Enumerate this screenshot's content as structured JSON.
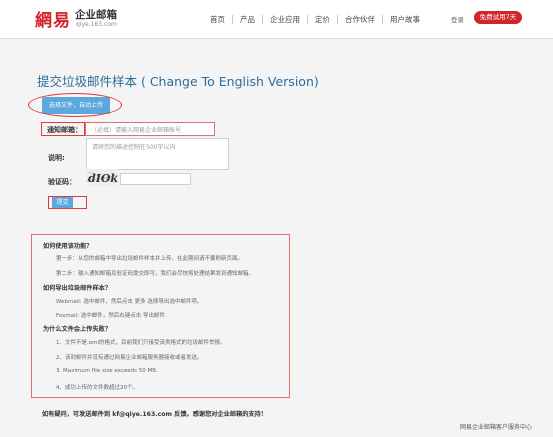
{
  "header": {
    "logo_mark": "網易",
    "logo_title": "企业邮箱",
    "logo_sub": "qiye.163.com",
    "nav": [
      {
        "label": "首页",
        "name": "nav-home"
      },
      {
        "label": "产品",
        "name": "nav-product"
      },
      {
        "label": "企业应用",
        "name": "nav-enterprise-apps"
      },
      {
        "label": "定价",
        "name": "nav-pricing"
      },
      {
        "label": "合作伙伴",
        "name": "nav-partners"
      },
      {
        "label": "用户故事",
        "name": "nav-user-stories"
      }
    ],
    "login_label": "登录",
    "trial_label": "免费试用7天"
  },
  "page": {
    "title": "提交垃圾邮件样本 ( Change To English Version)"
  },
  "form": {
    "upload_label": "选择文件，自动上传",
    "notify_label": "通知邮箱：",
    "notify_placeholder": "（必填）请输入网易企业邮箱帐号",
    "desc_label": "说明:",
    "desc_placeholder": "请将您的描述控制在500字以内",
    "captcha_label": "验证码：",
    "captcha_text": "dIOk",
    "submit_label": "提交"
  },
  "help": {
    "q1": "如何使用该功能？",
    "q1_step1": "第一步：从您的邮箱中导出垃圾邮件样本并上传，在此期间请不要刷新页面。",
    "q1_step2": "第二步：输入通知邮箱及验证码提交即可，我们会尽快将处理结果发到通知邮箱。",
    "q2": "如何导出垃圾邮件样本？",
    "q2_webmail": "Webmail: 选中邮件，然后点击 更多 选择导出选中邮件项。",
    "q2_foxmail": "Foxmail: 选中邮件，然后右键点击 导出邮件.",
    "q3": "为什么文件会上传失败？",
    "q3_r1": "1、文件不是.eml的格式，目前我们只接受该类格式的垃圾邮件举报。",
    "q3_r2": "2、该封邮件并没有通过网易企业邮箱服务器接收或者发送。",
    "q3_r3": "3. Maximum file size exceeds 50 MB.",
    "q3_r4": "4、成功上传的文件数超过20个。"
  },
  "footer": {
    "contact": "如有疑问，可发送邮件到 kf@qiye.163.com 反馈。感谢您对企业邮箱的支持！",
    "service": "网易企业邮箱客户服务中心"
  },
  "colors": {
    "brand_red": "#d3232b",
    "button_blue": "#5aa8dc",
    "title_blue": "#2c6e9a",
    "annotation_red": "#e03a3a"
  }
}
